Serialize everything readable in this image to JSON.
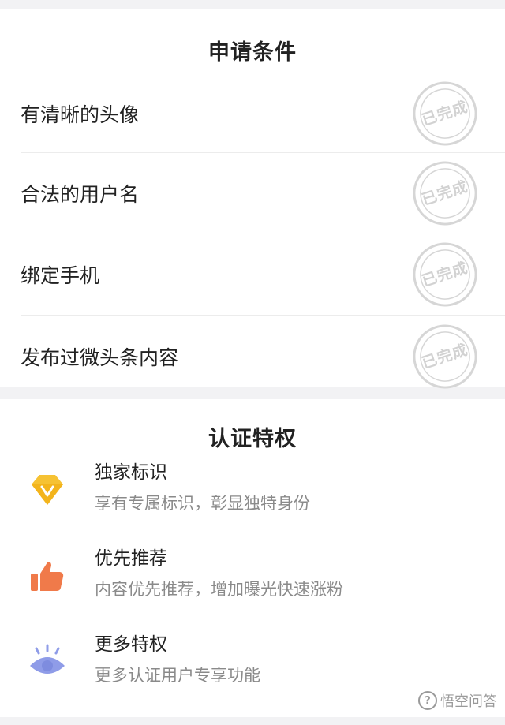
{
  "conditions": {
    "title": "申请条件",
    "stamp_text": "已完成",
    "items": [
      {
        "label": "有清晰的头像"
      },
      {
        "label": "合法的用户名"
      },
      {
        "label": "绑定手机"
      },
      {
        "label": "发布过微头条内容"
      }
    ]
  },
  "privileges": {
    "title": "认证特权",
    "items": [
      {
        "title": "独家标识",
        "desc": "享有专属标识，彰显独特身份",
        "icon": "diamond-badge-icon",
        "color": "#f6c233"
      },
      {
        "title": "优先推荐",
        "desc": "内容优先推荐，增加曝光快速涨粉",
        "icon": "thumbs-up-icon",
        "color": "#f07a4a"
      },
      {
        "title": "更多特权",
        "desc": "更多认证用户专享功能",
        "icon": "eye-icon",
        "color": "#8f9ce8"
      }
    ]
  },
  "watermark": {
    "text": "悟空问答",
    "icon": "question-mark-icon"
  }
}
